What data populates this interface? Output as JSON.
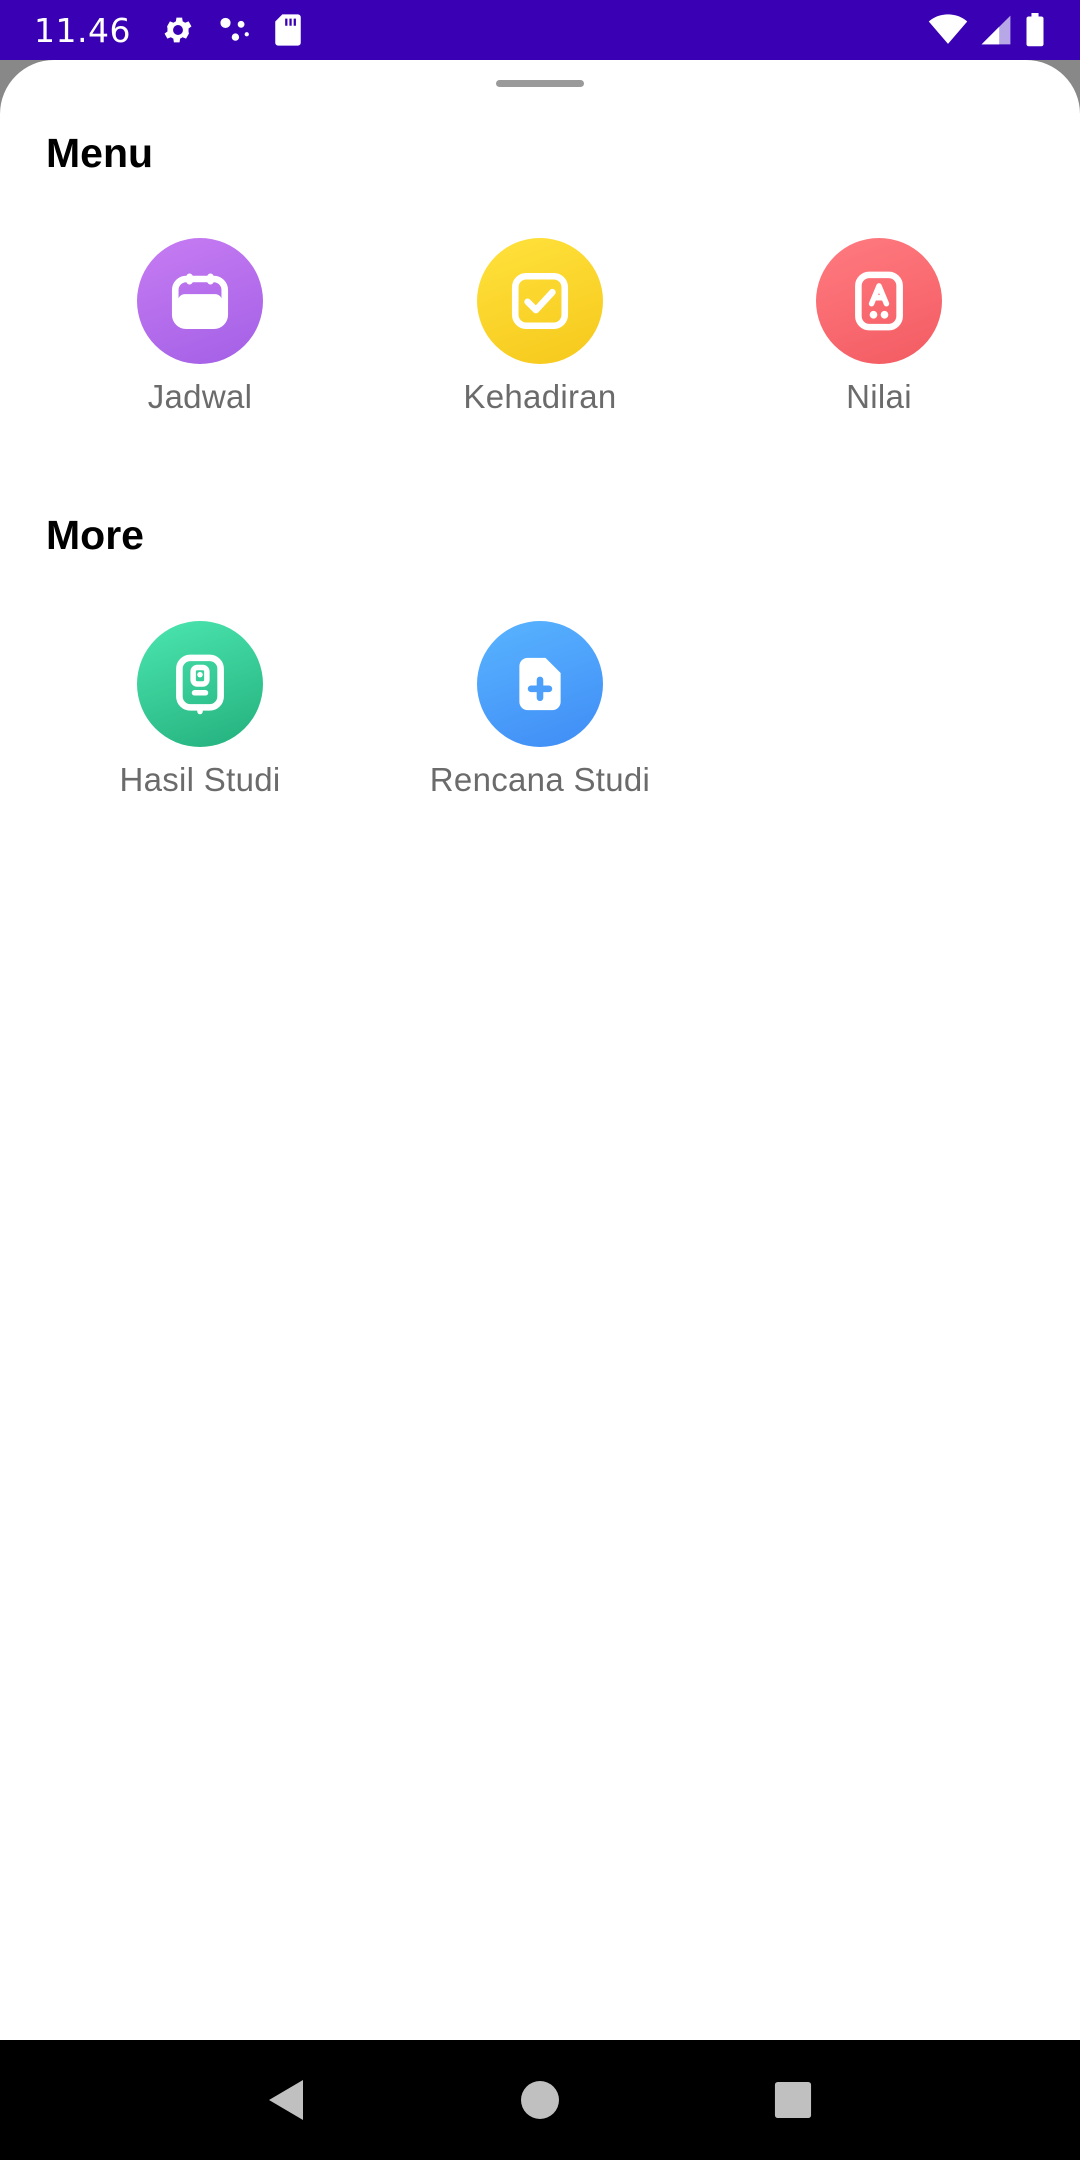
{
  "status_bar": {
    "time": "11.46",
    "left_icons": [
      "settings-icon",
      "dots-icon",
      "sd-card-icon"
    ],
    "right_icons": [
      "wifi-icon",
      "signal-icon",
      "battery-icon"
    ],
    "background": "#3a00b4"
  },
  "sheet": {
    "sections": [
      {
        "title": "Menu",
        "items": [
          {
            "label": "Jadwal",
            "icon": "calendar-icon",
            "color": "#b56cee"
          },
          {
            "label": "Kehadiran",
            "icon": "checkbox-icon",
            "color": "#fbd52b"
          },
          {
            "label": "Nilai",
            "icon": "grade-icon",
            "color": "#f96b71"
          }
        ]
      },
      {
        "title": "More",
        "items": [
          {
            "label": "Hasil Studi",
            "icon": "id-card-icon",
            "color": "#36c994"
          },
          {
            "label": "Rencana Studi",
            "icon": "add-document-icon",
            "color": "#4c9ffb"
          }
        ]
      }
    ]
  },
  "nav_bar": {
    "buttons": [
      "back-icon",
      "home-icon",
      "recents-icon"
    ]
  }
}
